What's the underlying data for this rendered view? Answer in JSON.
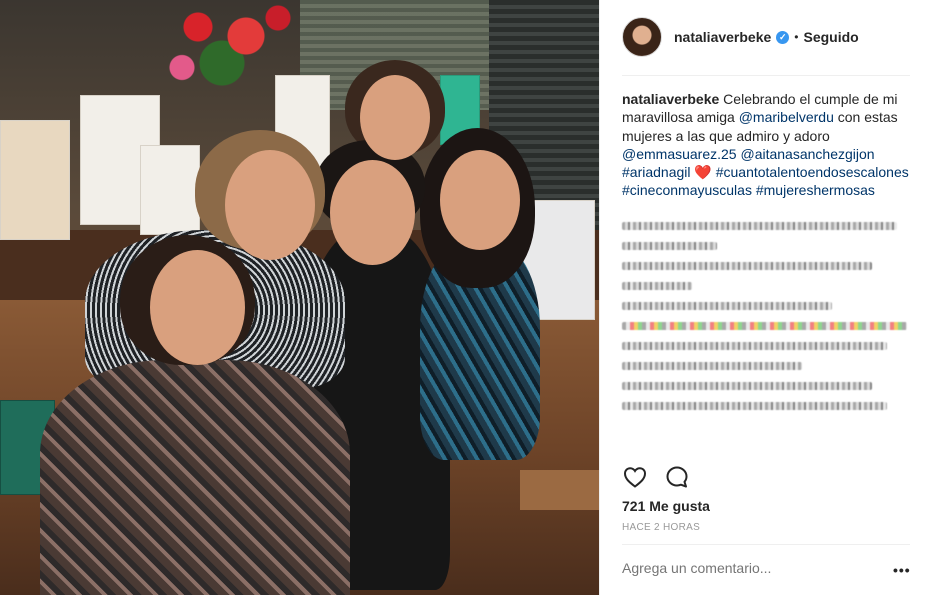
{
  "post": {
    "username": "nataliaverbeke",
    "follow_status": "Seguido",
    "separator": "•",
    "caption": {
      "author": "nataliaverbeke",
      "text_1": " Celebrando el cumple de mi maravillosa amiga ",
      "mention_1": "@maribelverdu",
      "text_2": " con estas mujeres a las que admiro y adoro ",
      "mention_2": "@emmasuarez.25",
      "mention_3": "@aitanasanchezgijon",
      "hashtag_1": "#ariadnagil",
      "heart": "❤️",
      "hashtag_2": "#cuantotalentoendosescalones",
      "hashtag_3": "#cineconmayusculas",
      "hashtag_4": "#mujereshermosas"
    },
    "likes": "721 Me gusta",
    "time": "HACE 2 HORAS",
    "comment_placeholder": "Agrega un comentario...",
    "more_icon": "•••"
  },
  "icons": {
    "verified": "verified-badge-icon",
    "like": "heart-outline-icon",
    "comment": "speech-bubble-icon",
    "more": "ellipsis-icon"
  },
  "colors": {
    "link": "#003569",
    "verified": "#3897f0",
    "muted": "#999999",
    "text": "#262626"
  }
}
